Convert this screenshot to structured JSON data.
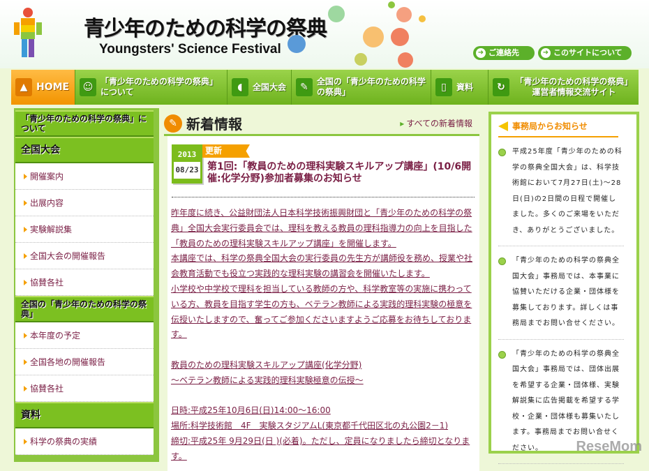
{
  "header": {
    "title_ja": "青少年のための科学の祭典",
    "title_en": "Youngsters' Science Festival",
    "logo_text": "YOUNGSTERS' SCIENCE FESTIVAL",
    "contact_label": "ご連絡先",
    "about_site_label": "このサイトについて"
  },
  "nav": [
    {
      "label": "HOME",
      "icon": "home-icon"
    },
    {
      "label": "「青少年のための科学の祭典」について",
      "icon": "person-icon"
    },
    {
      "label": "全国大会",
      "icon": "megaphone-icon"
    },
    {
      "label": "全国の「青少年のための科学の祭典」",
      "icon": "japan-map-icon"
    },
    {
      "label": "資料",
      "icon": "book-icon"
    },
    {
      "label": "「青少年のための科学の祭典」運営者情報交流サイト",
      "icon": "refresh-icon"
    }
  ],
  "sidebar": {
    "about": "「青少年のための科学の祭典」について",
    "national": "全国大会",
    "national_items": [
      "開催案内",
      "出展内容",
      "実験解説集",
      "全国大会の開催報告",
      "協賛各社"
    ],
    "regional": "全国の「青少年のための科学の祭典」",
    "regional_items": [
      "本年度の予定",
      "全国各地の開催報告",
      "協賛各社"
    ],
    "materials": "資料",
    "materials_items": [
      "科学の祭典の実績"
    ]
  },
  "main": {
    "title": "新着情報",
    "all_link": "すべての新着情報",
    "news": {
      "year": "2013",
      "date": "08/23",
      "badge": "更新",
      "title": "第1回:「教員のための理科実験スキルアップ講座」(10/6開催:化学分野)参加者募集のお知らせ",
      "paragraphs": [
        "昨年度に続き、公益財団法人日本科学技術振興財団と「青少年のための科学の祭典」全国大会実行委員会では、理科を教える教員の理科指導力の向上を目指した「教員のための理科実験スキルアップ講座」を開催します。",
        "本講座では、科学の祭典全国大会の実行委員の先生方が講師役を務め、授業や社会教育活動でも役立つ実践的な理科実験の講習会を開催いたします。",
        "小学校や中学校で理科を担当している教師の方や、科学教室等の実施に携わっている方、教員を目指す学生の方も、ベテラン教師による実践的理科実験の極意を伝授いたしますので、奮ってご参加くださいますようご応募をお待ちしております。",
        "教員のための理科実験スキルアップ講座(化学分野)",
        "～ベテラン教師による実践的理科実験極意の伝授～",
        "日時:平成25年10月6日(日)14:00～16:00",
        "場所:科学技術館　4F　実験スタジアムL(東京都千代田区北の丸公園2－1)",
        "締切:平成25年 9月29日(日 )(必着)。ただし、定員になりましたら締切となります。"
      ]
    }
  },
  "notices": {
    "title": "事務局からお知らせ",
    "items": [
      "平成25年度「青少年のための科学の祭典全国大会」は、科学技術館において7月27日(土)～28日(日)の2日間の日程で開催しました。多くのご来場をいただき、ありがとうございました。",
      "「青少年のための科学の祭典全国大会」事務局では、本事業に協賛いただける企業・団体様を募集しております。詳しくは事務局までお問い合せください。",
      "「青少年のための科学の祭典全国大会」事務局では、団体出展を希望する企業・団体様、実験解説集に広告掲載を希望する学校・企業・団体様も募集いたします。事務局までお問い合せください。"
    ]
  },
  "watermark": "ReseMom"
}
